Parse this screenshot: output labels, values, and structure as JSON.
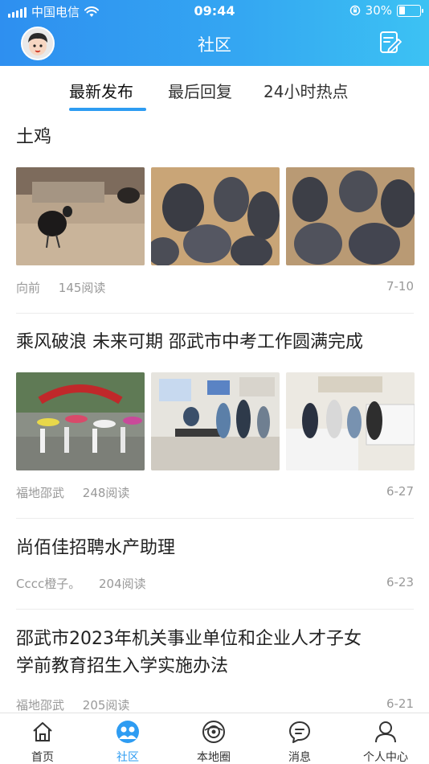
{
  "status_bar": {
    "carrier": "中国电信",
    "time": "09:44",
    "battery": "30%",
    "battery_level": 0.3
  },
  "header": {
    "title": "社区",
    "avatar_icon": "avatar-icon",
    "compose_icon": "compose-icon",
    "gradient": [
      "#2e8ff0",
      "#3cc2f3"
    ]
  },
  "tabs": [
    {
      "label": "最新发布",
      "active": true
    },
    {
      "label": "最后回复",
      "active": false
    },
    {
      "label": "24小时热点",
      "active": false
    }
  ],
  "posts": [
    {
      "title": "土鸡",
      "author": "向前",
      "reads": "145阅读",
      "date": "7-10",
      "image_count": 3
    },
    {
      "title": "乘风破浪 未来可期 邵武市中考工作圆满完成",
      "author": "福地邵武",
      "reads": "248阅读",
      "date": "6-27",
      "image_count": 3
    },
    {
      "title": "尚佰佳招聘水产助理",
      "author": "Cccc橙子。",
      "reads": "204阅读",
      "date": "6-23",
      "image_count": 0
    },
    {
      "title_line1": "邵武市2023年机关事业单位和企业人才子女",
      "title_line2": "学前教育招生入学实施办法",
      "author": "福地邵武",
      "reads": "205阅读",
      "date": "6-21",
      "image_count": 0
    }
  ],
  "tabbar": [
    {
      "label": "首页",
      "icon": "home-icon",
      "active": false
    },
    {
      "label": "社区",
      "icon": "community-icon",
      "active": true
    },
    {
      "label": "本地圈",
      "icon": "local-circle-icon",
      "active": false
    },
    {
      "label": "消息",
      "icon": "message-icon",
      "active": false
    },
    {
      "label": "个人中心",
      "icon": "profile-icon",
      "active": false
    }
  ],
  "colors": {
    "accent": "#2e9cf2",
    "meta_text": "#999999"
  }
}
